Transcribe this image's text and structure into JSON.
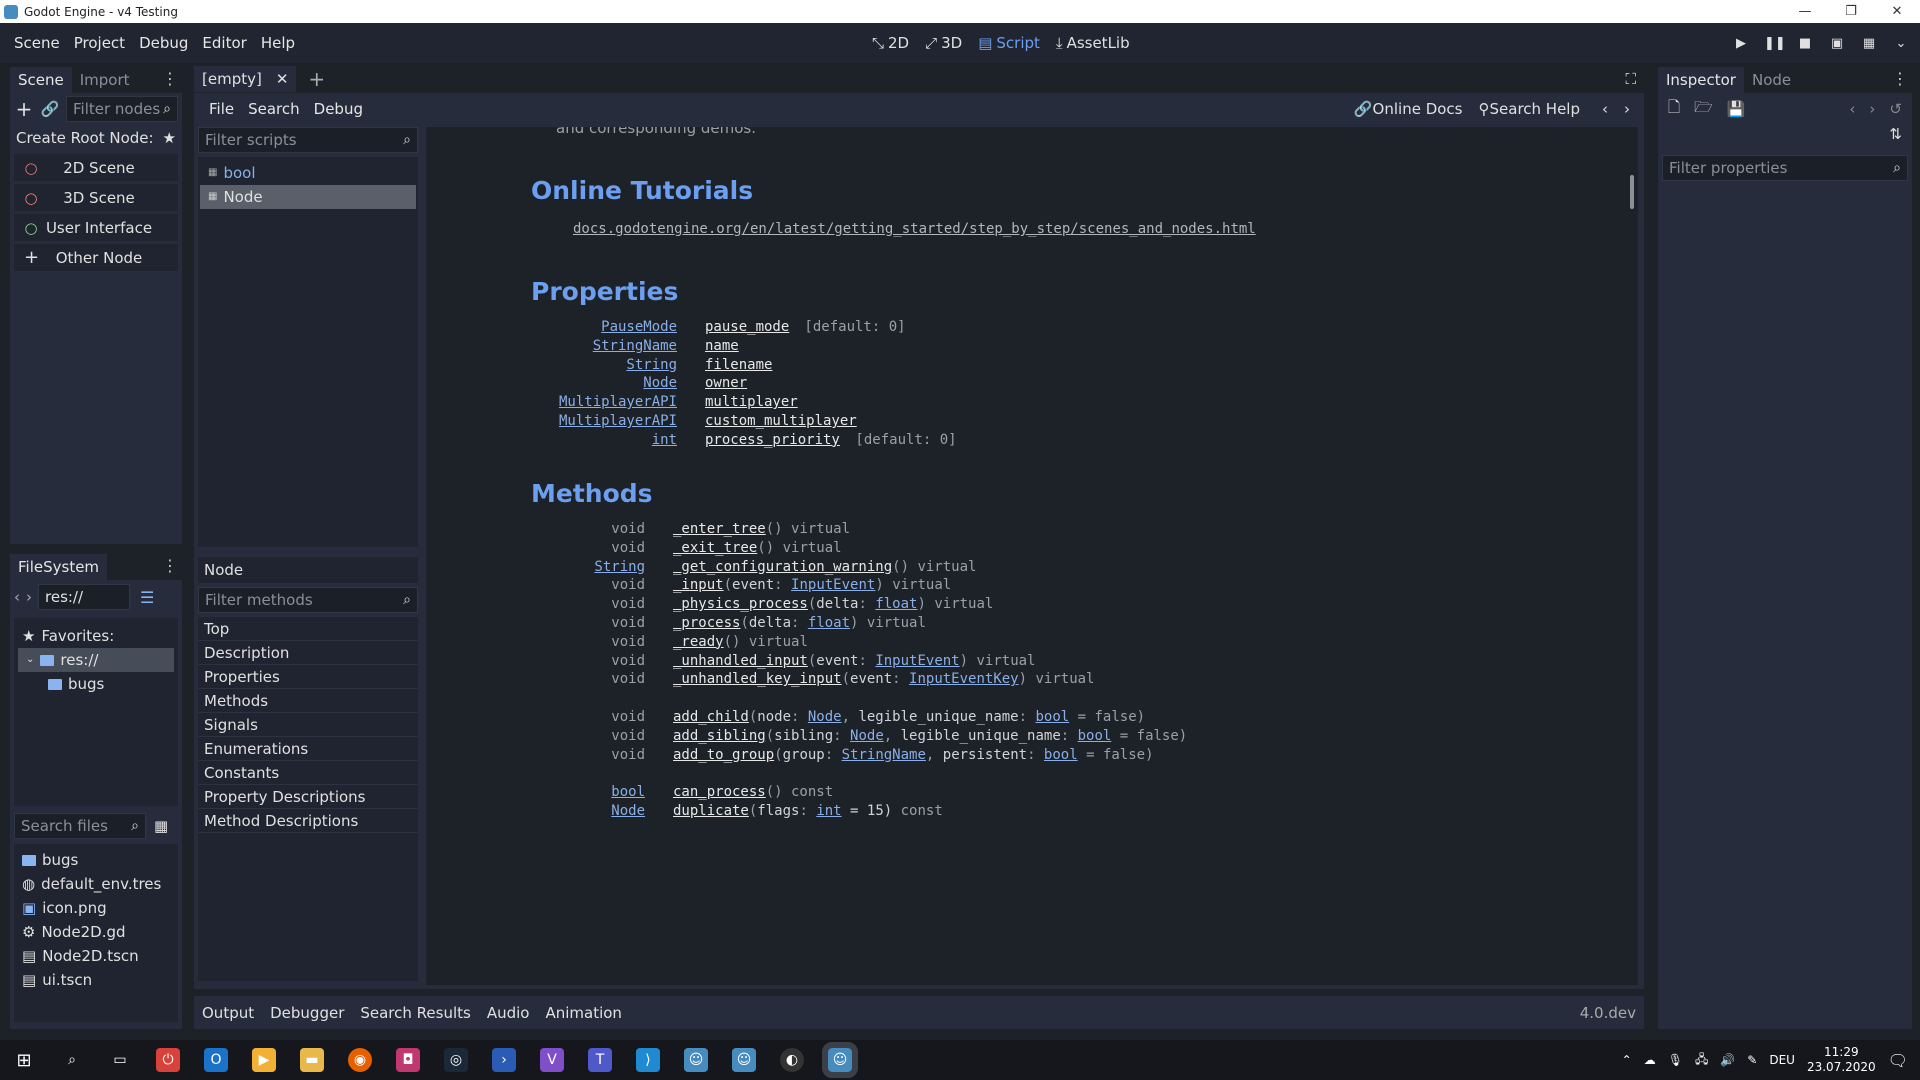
{
  "window": {
    "title": "Godot Engine - v4 Testing"
  },
  "menu": [
    "Scene",
    "Project",
    "Debug",
    "Editor",
    "Help"
  ],
  "workspaces": [
    {
      "label": "2D",
      "icon": "2d-icon"
    },
    {
      "label": "3D",
      "icon": "3d-icon"
    },
    {
      "label": "Script",
      "icon": "script-icon",
      "active": true
    },
    {
      "label": "AssetLib",
      "icon": "assetlib-icon"
    }
  ],
  "scene_dock": {
    "tabs": [
      "Scene",
      "Import"
    ],
    "filter_placeholder": "Filter nodes",
    "create_root_label": "Create Root Node:",
    "root_buttons": [
      {
        "label": "2D Scene",
        "icon": "circle-red-icon",
        "color": "#e07a7a"
      },
      {
        "label": "3D Scene",
        "icon": "circle-red-icon",
        "color": "#f08080"
      },
      {
        "label": "User Interface",
        "icon": "circle-green-icon",
        "color": "#8ed18e"
      },
      {
        "label": "Other Node",
        "icon": "plus-icon",
        "color": "#e0e0e0"
      }
    ]
  },
  "filesystem": {
    "tab": "FileSystem",
    "path": "res://",
    "favorites_label": "Favorites:",
    "tree": [
      "res://",
      "bugs"
    ],
    "search_placeholder": "Search files",
    "files": [
      {
        "name": "bugs",
        "icon": "folder-icon"
      },
      {
        "name": "default_env.tres",
        "icon": "globe-icon"
      },
      {
        "name": "icon.png",
        "icon": "image-icon"
      },
      {
        "name": "Node2D.gd",
        "icon": "gear-icon"
      },
      {
        "name": "Node2D.tscn",
        "icon": "scene-icon"
      },
      {
        "name": "ui.tscn",
        "icon": "scene-icon"
      }
    ]
  },
  "script_editor": {
    "tab_label": "[empty]",
    "menu": [
      "File",
      "Search",
      "Debug"
    ],
    "online_docs": "Online Docs",
    "search_help": "Search Help",
    "filter_scripts_placeholder": "Filter scripts",
    "scripts": [
      "bool",
      "Node"
    ],
    "current": "Node",
    "filter_methods_placeholder": "Filter methods",
    "outline": [
      "Top",
      "Description",
      "Properties",
      "Methods",
      "Signals",
      "Enumerations",
      "Constants",
      "Property Descriptions",
      "Method Descriptions"
    ]
  },
  "docs": {
    "cut_text": "and corresponding demos.",
    "tutorials_heading": "Online Tutorials",
    "tutorial_link": "docs.godotengine.org/en/latest/getting_started/step_by_step/scenes_and_nodes.html",
    "properties_heading": "Properties",
    "properties": [
      {
        "type": "PauseMode",
        "name": "pause_mode",
        "default": "[default: 0]"
      },
      {
        "type": "StringName",
        "name": "name",
        "default": ""
      },
      {
        "type": "String",
        "name": "filename",
        "default": ""
      },
      {
        "type": "Node",
        "name": "owner",
        "default": ""
      },
      {
        "type": "MultiplayerAPI",
        "name": "multiplayer",
        "default": ""
      },
      {
        "type": "MultiplayerAPI",
        "name": "custom_multiplayer",
        "default": ""
      },
      {
        "type": "int",
        "name": "process_priority",
        "default": "[default: 0]"
      }
    ],
    "methods_heading": "Methods",
    "methods": [
      {
        "ret": "void",
        "ret_link": false,
        "name": "_enter_tree",
        "args": "()",
        "qual": " virtual"
      },
      {
        "ret": "void",
        "ret_link": false,
        "name": "_exit_tree",
        "args": "()",
        "qual": " virtual"
      },
      {
        "ret": "String",
        "ret_link": true,
        "name": "_get_configuration_warning",
        "args": "()",
        "qual": " virtual"
      },
      {
        "ret": "void",
        "ret_link": false,
        "name": "_input",
        "args": "(event: InputEvent)",
        "qual": " virtual"
      },
      {
        "ret": "void",
        "ret_link": false,
        "name": "_physics_process",
        "args": "(delta: float)",
        "qual": " virtual"
      },
      {
        "ret": "void",
        "ret_link": false,
        "name": "_process",
        "args": "(delta: float)",
        "qual": " virtual"
      },
      {
        "ret": "void",
        "ret_link": false,
        "name": "_ready",
        "args": "()",
        "qual": " virtual"
      },
      {
        "ret": "void",
        "ret_link": false,
        "name": "_unhandled_input",
        "args": "(event: InputEvent)",
        "qual": " virtual"
      },
      {
        "ret": "void",
        "ret_link": false,
        "name": "_unhandled_key_input",
        "args": "(event: InputEventKey)",
        "qual": " virtual"
      },
      {
        "ret": "void",
        "ret_link": false,
        "name": "add_child",
        "args": "(node: Node, legible_unique_name: bool = false)",
        "qual": "",
        "gap": true
      },
      {
        "ret": "void",
        "ret_link": false,
        "name": "add_sibling",
        "args": "(sibling: Node, legible_unique_name: bool = false)",
        "qual": ""
      },
      {
        "ret": "void",
        "ret_link": false,
        "name": "add_to_group",
        "args": "(group: StringName, persistent: bool = false)",
        "qual": ""
      },
      {
        "ret": "bool",
        "ret_link": true,
        "name": "can_process",
        "args": "()",
        "qual": " const",
        "gap": true
      },
      {
        "ret": "Node",
        "ret_link": true,
        "name": "duplicate",
        "args": "(flags: int = 15)",
        "qual": " const"
      }
    ]
  },
  "inspector": {
    "tabs": [
      "Inspector",
      "Node"
    ],
    "filter_placeholder": "Filter properties"
  },
  "bottom_panel": [
    "Output",
    "Debugger",
    "Search Results",
    "Audio",
    "Animation"
  ],
  "version": "4.0.dev",
  "taskbar": {
    "lang": "DEU",
    "time": "11:29",
    "date": "23.07.2020"
  }
}
